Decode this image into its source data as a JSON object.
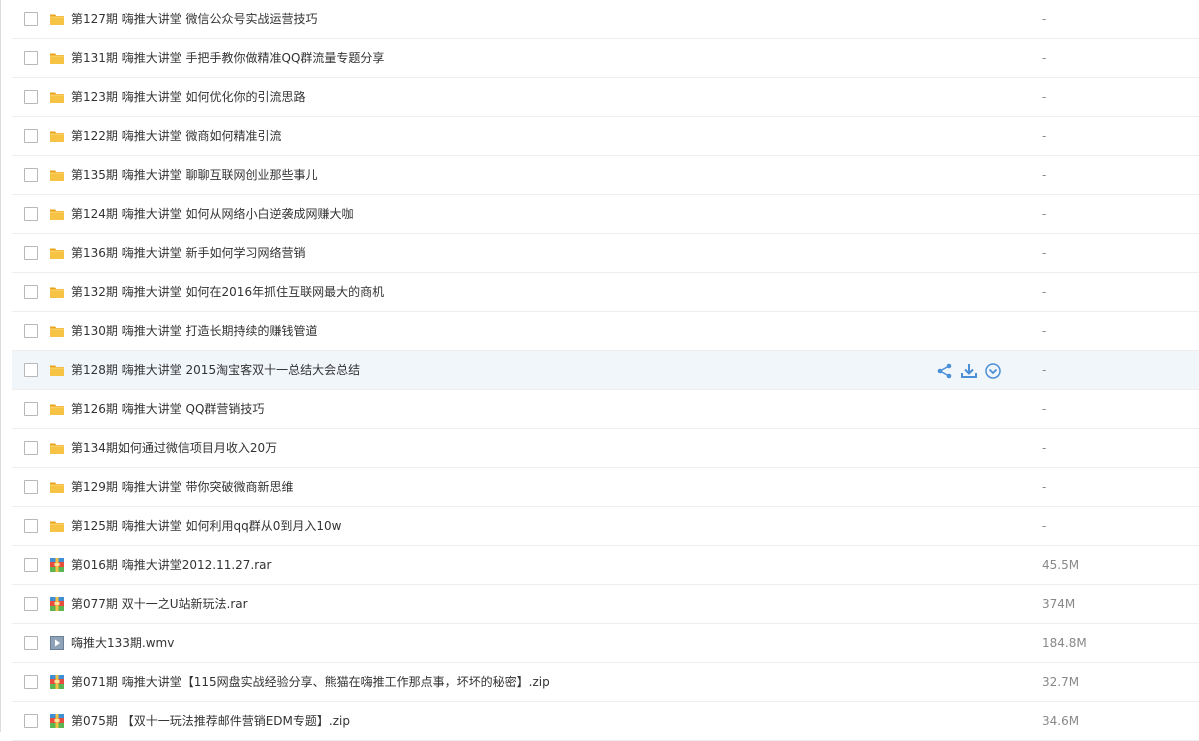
{
  "file_list": {
    "items": [
      {
        "name": "第127期 嗨推大讲堂 微信公众号实战运营技巧",
        "size": "-",
        "type": "folder"
      },
      {
        "name": "第131期 嗨推大讲堂 手把手教你做精准QQ群流量专题分享",
        "size": "-",
        "type": "folder"
      },
      {
        "name": "第123期 嗨推大讲堂 如何优化你的引流思路",
        "size": "-",
        "type": "folder"
      },
      {
        "name": "第122期 嗨推大讲堂 微商如何精准引流",
        "size": "-",
        "type": "folder"
      },
      {
        "name": "第135期 嗨推大讲堂 聊聊互联网创业那些事儿",
        "size": "-",
        "type": "folder"
      },
      {
        "name": "第124期 嗨推大讲堂 如何从网络小白逆袭成网赚大咖",
        "size": "-",
        "type": "folder"
      },
      {
        "name": "第136期 嗨推大讲堂 新手如何学习网络营销",
        "size": "-",
        "type": "folder"
      },
      {
        "name": "第132期 嗨推大讲堂 如何在2016年抓住互联网最大的商机",
        "size": "-",
        "type": "folder"
      },
      {
        "name": "第130期 嗨推大讲堂 打造长期持续的赚钱管道",
        "size": "-",
        "type": "folder"
      },
      {
        "name": "第128期 嗨推大讲堂 2015淘宝客双十一总结大会总结",
        "size": "-",
        "type": "folder",
        "hovered": true
      },
      {
        "name": "第126期 嗨推大讲堂 QQ群营销技巧",
        "size": "-",
        "type": "folder"
      },
      {
        "name": "第134期如何通过微信项目月收入20万",
        "size": "-",
        "type": "folder"
      },
      {
        "name": "第129期 嗨推大讲堂 带你突破微商新思维",
        "size": "-",
        "type": "folder"
      },
      {
        "name": "第125期 嗨推大讲堂 如何利用qq群从0到月入10w",
        "size": "-",
        "type": "folder"
      },
      {
        "name": "第016期 嗨推大讲堂2012.11.27.rar",
        "size": "45.5M",
        "type": "archive"
      },
      {
        "name": "第077期 双十一之U站新玩法.rar",
        "size": "374M",
        "type": "archive"
      },
      {
        "name": "嗨推大133期.wmv",
        "size": "184.8M",
        "type": "video"
      },
      {
        "name": "第071期 嗨推大讲堂【115网盘实战经验分享、熊猫在嗨推工作那点事，坏坏的秘密】.zip",
        "size": "32.7M",
        "type": "archive"
      },
      {
        "name": "第075期 【双十一玩法推荐邮件营销EDM专题】.zip",
        "size": "34.6M",
        "type": "archive"
      }
    ]
  },
  "icons": {
    "folder": "folder-icon",
    "archive": "archive-file-icon",
    "video": "video-file-icon",
    "share": "share-icon",
    "download": "download-icon",
    "more": "more-options-icon"
  },
  "colors": {
    "hover_row": "#f1f6fb",
    "action_blue": "#4b8fd6",
    "folder_yellow": "#f6c344",
    "size_gray": "#888888"
  }
}
